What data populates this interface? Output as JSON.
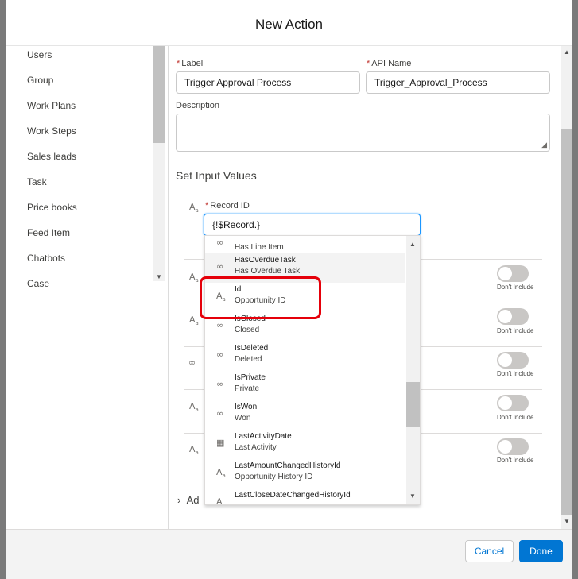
{
  "modal": {
    "title": "New Action"
  },
  "left_list": {
    "items": [
      "Users",
      "Group",
      "Work Plans",
      "Work Steps",
      "Sales leads",
      "Task",
      "Price books",
      "Feed Item",
      "Chatbots",
      "Case"
    ]
  },
  "form": {
    "label_field": {
      "label": "Label",
      "value": "Trigger Approval Process"
    },
    "api_name_field": {
      "label": "API Name",
      "value": "Trigger_Approval_Process"
    },
    "description_field": {
      "label": "Description",
      "value": ""
    },
    "section_title": "Set Input Values",
    "record_id": {
      "label": "Record ID",
      "value": "{!$Record.}"
    },
    "toggle_label": "Don't Include",
    "advanced_label": "Ad"
  },
  "dropdown": {
    "items": [
      {
        "api": "",
        "label": "Has Line Item",
        "icon": "link-icon"
      },
      {
        "api": "HasOverdueTask",
        "label": "Has Overdue Task",
        "icon": "link-icon"
      },
      {
        "api": "Id",
        "label": "Opportunity ID",
        "icon": "text-type-icon"
      },
      {
        "api": "IsClosed",
        "label": "Closed",
        "icon": "link-icon"
      },
      {
        "api": "IsDeleted",
        "label": "Deleted",
        "icon": "link-icon"
      },
      {
        "api": "IsPrivate",
        "label": "Private",
        "icon": "link-icon"
      },
      {
        "api": "IsWon",
        "label": "Won",
        "icon": "link-icon"
      },
      {
        "api": "LastActivityDate",
        "label": "Last Activity",
        "icon": "calendar-icon"
      },
      {
        "api": "LastAmountChangedHistoryId",
        "label": "Opportunity History ID",
        "icon": "text-type-icon"
      },
      {
        "api": "LastCloseDateChangedHistoryId",
        "label": "",
        "icon": "text-type-icon"
      }
    ]
  },
  "footer": {
    "cancel_label": "Cancel",
    "done_label": "Done"
  },
  "colors": {
    "brand": "#0176d3",
    "highlight": "#e5000a",
    "required": "#c23934"
  }
}
